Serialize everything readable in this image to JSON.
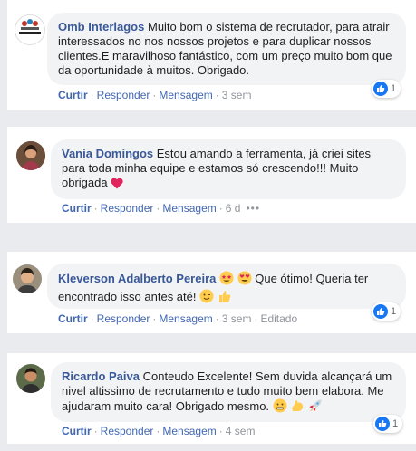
{
  "comments": [
    {
      "author": "Omb Interlagos",
      "text": "Muito bom o sistema de recrutador, para atrair interessados no nos nossos projetos e para duplicar nossos clientes.E maravilhoso fantástico, com um preço muito bom que da oportunidade à muitos. Obrigado.",
      "avatar_text": "INTERLAGOS",
      "actions": {
        "like": "Curtir",
        "reply": "Responder",
        "message": "Mensagem",
        "time": "3 sem"
      },
      "reactions": "1"
    },
    {
      "author": "Vania Domingos",
      "text": "Estou amando a ferramenta, já criei sites para toda minha equipe e estamos só crescendo!!! Muito obrigada",
      "actions": {
        "like": "Curtir",
        "reply": "Responder",
        "message": "Mensagem",
        "time": "6 d"
      }
    },
    {
      "author": "Kleverson Adalberto Pereira",
      "text": "Que ótimo! Queria ter encontrado isso antes até!",
      "actions": {
        "like": "Curtir",
        "reply": "Responder",
        "message": "Mensagem",
        "time": "3 sem",
        "edited": "Editado"
      },
      "reactions": "1"
    },
    {
      "author": "Ricardo Paiva",
      "text": "Conteudo Excelente! Sem duvida alcançará um nivel altissimo de recrutamento e tudo muito bem elabora. Me ajudaram muito cara! Obrigado mesmo.",
      "actions": {
        "like": "Curtir",
        "reply": "Responder",
        "message": "Mensagem",
        "time": "4 sem"
      },
      "reactions": "1"
    }
  ],
  "colors": {
    "author": "#385898",
    "link": "#4267b2",
    "bubble": "#f2f3f5",
    "like": "#1877f2"
  }
}
